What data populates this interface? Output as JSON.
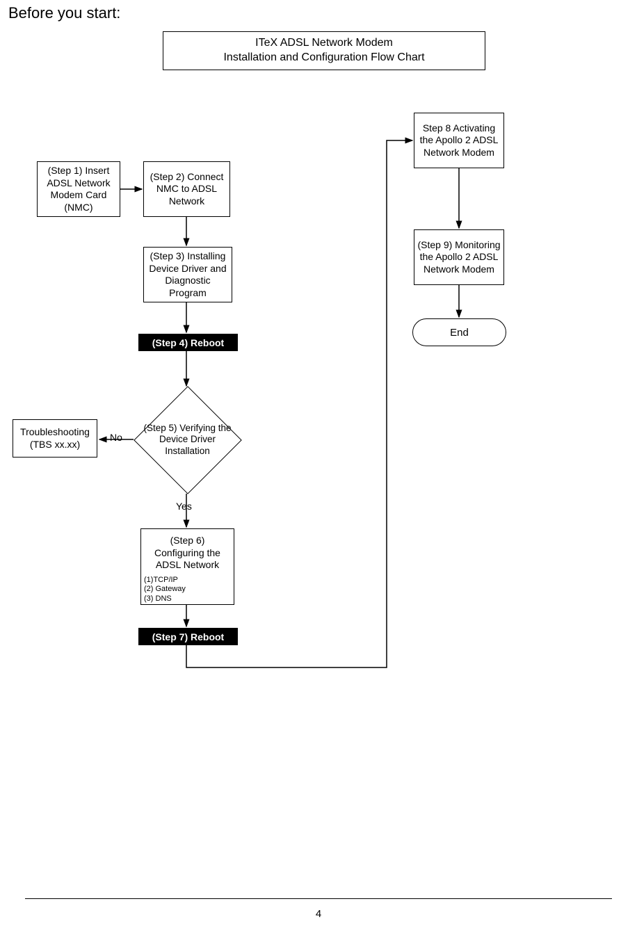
{
  "heading": "Before you start:",
  "title_line1": "ITeX ADSL Network Modem",
  "title_line2": "Installation and Configuration Flow Chart",
  "step1": "(Step 1) Insert ADSL Network Modem Card (NMC)",
  "step2": "(Step 2) Connect NMC to ADSL Network",
  "step3": "(Step 3) Installing Device Driver and Diagnostic Program",
  "step4": "(Step 4) Reboot",
  "step5": "(Step 5) Verifying the Device Driver Installation",
  "troubleshoot": "Troubleshooting (TBS xx.xx)",
  "step6_main": "(Step 6) Configuring the ADSL Network",
  "step6_sub1": "(1)TCP/IP",
  "step6_sub2": "(2) Gateway",
  "step6_sub3": "(3) DNS",
  "step7": "(Step 7) Reboot",
  "step8": "Step 8 Activating the Apollo 2 ADSL Network Modem",
  "step9": "(Step 9) Monitoring the Apollo 2 ADSL Network Modem",
  "end": "End",
  "label_no": "No",
  "label_yes": "Yes",
  "page_number": "4",
  "chart_data": {
    "type": "flowchart",
    "title": "ITeX ADSL Network Modem Installation and Configuration Flow Chart",
    "nodes": [
      {
        "id": "step1",
        "type": "process",
        "label": "(Step 1) Insert ADSL Network Modem Card (NMC)"
      },
      {
        "id": "step2",
        "type": "process",
        "label": "(Step 2) Connect NMC to ADSL Network"
      },
      {
        "id": "step3",
        "type": "process",
        "label": "(Step 3) Installing Device Driver and Diagnostic Program"
      },
      {
        "id": "step4",
        "type": "process-emphasis",
        "label": "(Step 4) Reboot"
      },
      {
        "id": "step5",
        "type": "decision",
        "label": "(Step 5) Verifying the Device Driver Installation"
      },
      {
        "id": "troubleshoot",
        "type": "process",
        "label": "Troubleshooting (TBS xx.xx)"
      },
      {
        "id": "step6",
        "type": "process",
        "label": "(Step 6) Configuring the ADSL Network",
        "sub": [
          "(1)TCP/IP",
          "(2) Gateway",
          "(3) DNS"
        ]
      },
      {
        "id": "step7",
        "type": "process-emphasis",
        "label": "(Step 7) Reboot"
      },
      {
        "id": "step8",
        "type": "process",
        "label": "Step 8 Activating the Apollo 2 ADSL Network Modem"
      },
      {
        "id": "step9",
        "type": "process",
        "label": "(Step 9) Monitoring the Apollo 2 ADSL Network Modem"
      },
      {
        "id": "end",
        "type": "terminator",
        "label": "End"
      }
    ],
    "edges": [
      {
        "from": "step1",
        "to": "step2"
      },
      {
        "from": "step2",
        "to": "step3"
      },
      {
        "from": "step3",
        "to": "step4"
      },
      {
        "from": "step4",
        "to": "step5"
      },
      {
        "from": "step5",
        "to": "troubleshoot",
        "label": "No"
      },
      {
        "from": "step5",
        "to": "step6",
        "label": "Yes"
      },
      {
        "from": "step6",
        "to": "step7"
      },
      {
        "from": "step7",
        "to": "step8"
      },
      {
        "from": "step8",
        "to": "step9"
      },
      {
        "from": "step9",
        "to": "end"
      }
    ]
  }
}
